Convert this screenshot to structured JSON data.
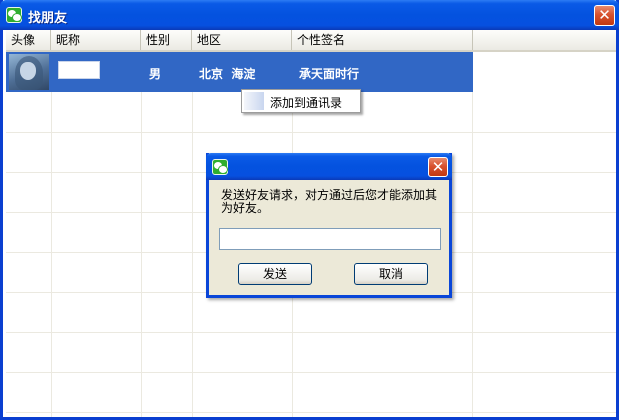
{
  "window": {
    "title": "找朋友",
    "close_label": "✕",
    "app_icon": "wechat-icon"
  },
  "table": {
    "columns": [
      "头像",
      "昵称",
      "性别",
      "地区",
      "个性签名"
    ],
    "rows": [
      {
        "nickname": "",
        "gender": "男",
        "region": "北京  海淀",
        "signature": "承天面时行"
      }
    ]
  },
  "context_menu": {
    "items": [
      "添加到通讯录"
    ]
  },
  "dialog": {
    "close_label": "✕",
    "message": "发送好友请求，对方通过后您才能添加其为好友。",
    "input_value": "",
    "send_label": "发送",
    "cancel_label": "取消"
  },
  "colors": {
    "titlebar": "#0452df",
    "selection": "#3167c5",
    "dialog_bg": "#ece9d8",
    "close": "#d8522f"
  }
}
